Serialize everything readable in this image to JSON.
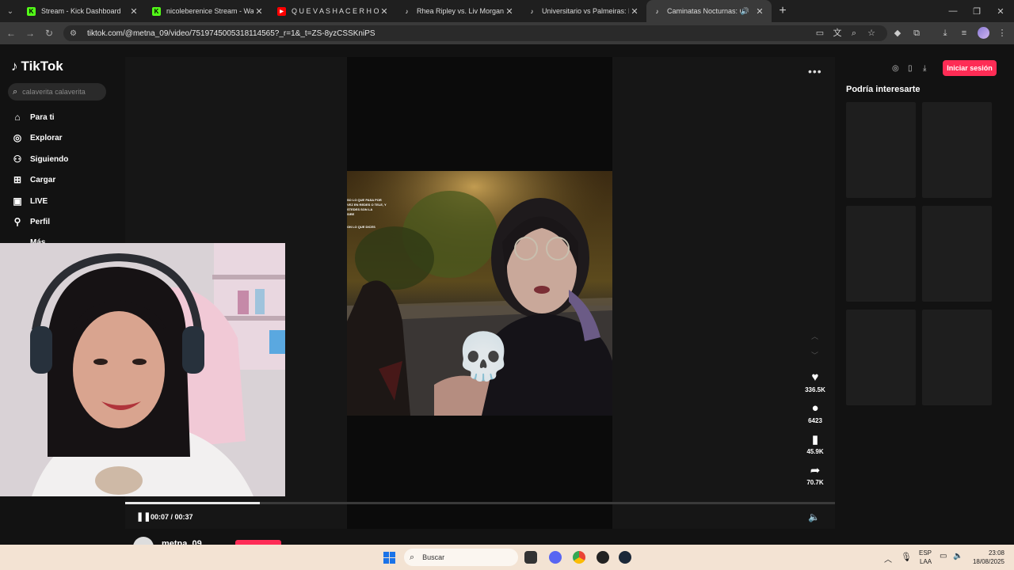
{
  "browser": {
    "tabs": [
      {
        "title": "Stream - Kick Dashboard",
        "favicon": "kick-icon",
        "color": "#53fc18"
      },
      {
        "title": "nicoleberenice Stream - Watch",
        "favicon": "kick-icon",
        "color": "#53fc18"
      },
      {
        "title": "Q U E V A S H A C E R H O Y ?",
        "favicon": "youtube-icon",
        "color": "#ff0000"
      },
      {
        "title": "Rhea Ripley vs. Liv Morgan: La",
        "favicon": "tiktok-icon",
        "color": "#000000"
      },
      {
        "title": "Universitario vs Palmeiras: Men",
        "favicon": "tiktok-icon",
        "color": "#000000"
      },
      {
        "title": "Caminatas Nocturnas: Cala",
        "favicon": "tiktok-icon",
        "color": "#000000",
        "active": true,
        "audio": true
      }
    ],
    "url": "tiktok.com/@metna_09/video/7519745005318114565?_r=1&_t=ZS-8yzCSSKniPS"
  },
  "tiktok": {
    "logo": "TikTok",
    "search_placeholder": "calaverita calaverita",
    "nav": [
      {
        "label": "Para ti",
        "icon": "home-icon"
      },
      {
        "label": "Explorar",
        "icon": "compass-icon"
      },
      {
        "label": "Siguiendo",
        "icon": "following-icon"
      },
      {
        "label": "Cargar",
        "icon": "upload-icon"
      },
      {
        "label": "LIVE",
        "icon": "live-icon"
      },
      {
        "label": "Perfil",
        "icon": "profile-icon"
      },
      {
        "label": "Más",
        "icon": "more-icon"
      }
    ],
    "video": {
      "overlay_lines": [
        "SO LO QUE PASA POR",
        "VEZ EN REDES O TELE, Y",
        "STEDES SON LA",
        "SIRE",
        "ON LO QUE DICES"
      ],
      "emoji": "💀",
      "likes": "336.5K",
      "comments": "6423",
      "saves": "45.9K",
      "shares": "70.7K",
      "time": "00:07 / 00:37",
      "progress": 0.19,
      "username": "metna_09"
    },
    "login_label": "Iniciar sesión",
    "suggest_title": "Podría interesarte"
  },
  "taskbar": {
    "search_label": "Buscar",
    "lang_top": "ESP",
    "lang_bottom": "LAA",
    "time": "23:08",
    "date": "18/08/2025"
  },
  "colors": {
    "accent": "#fe2c55",
    "background": "#121212"
  }
}
